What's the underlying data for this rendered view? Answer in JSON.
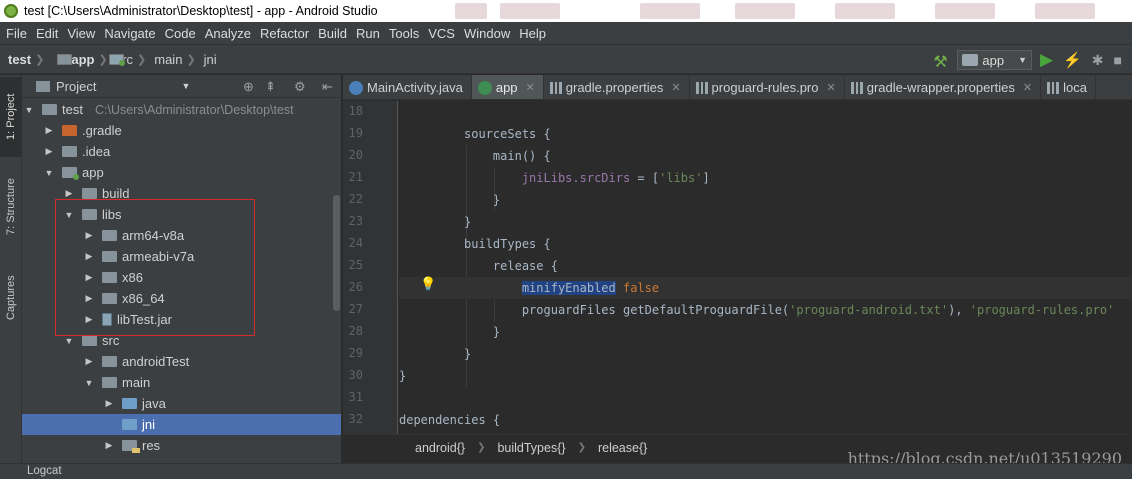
{
  "window": {
    "title": "test [C:\\Users\\Administrator\\Desktop\\test] - app - Android Studio"
  },
  "menu": [
    "File",
    "Edit",
    "View",
    "Navigate",
    "Code",
    "Analyze",
    "Refactor",
    "Build",
    "Run",
    "Tools",
    "VCS",
    "Window",
    "Help"
  ],
  "breadcrumb": [
    "test",
    "app",
    "src",
    "main",
    "jni"
  ],
  "run_config": "app",
  "left_tabs": [
    "1: Project",
    "7: Structure",
    "Captures"
  ],
  "project_panel": {
    "title": "Project",
    "tree": [
      {
        "label": "test",
        "path": "C:\\Users\\Administrator\\Desktop\\test"
      },
      {
        "label": ".gradle"
      },
      {
        "label": ".idea"
      },
      {
        "label": "app"
      },
      {
        "label": "build"
      },
      {
        "label": "libs"
      },
      {
        "label": "arm64-v8a"
      },
      {
        "label": "armeabi-v7a"
      },
      {
        "label": "x86"
      },
      {
        "label": "x86_64"
      },
      {
        "label": "libTest.jar"
      },
      {
        "label": "src"
      },
      {
        "label": "androidTest"
      },
      {
        "label": "main"
      },
      {
        "label": "java"
      },
      {
        "label": "jni"
      },
      {
        "label": "res"
      }
    ]
  },
  "tabs": [
    "MainActivity.java",
    "app",
    "gradle.properties",
    "proguard-rules.pro",
    "gradle-wrapper.properties",
    "loca"
  ],
  "editor": {
    "line_numbers": [
      "18",
      "19",
      "20",
      "21",
      "22",
      "23",
      "24",
      "25",
      "26",
      "27",
      "28",
      "29",
      "30",
      "31",
      "32"
    ],
    "code": {
      "l19": "sourceSets {",
      "l20": "main() {",
      "l21_field": "jniLibs.srcDirs",
      "l21_eq": " = [",
      "l21_str": "'libs'",
      "l21_end": "]",
      "l22": "}",
      "l23": "}",
      "l24": "buildTypes {",
      "l25": "release {",
      "l26_sel": "minifyEnabled",
      "l26_kw": "false",
      "l27_a": "proguardFiles getDefaultProguardFile(",
      "l27_s1": "'proguard-android.txt'",
      "l27_b": "), ",
      "l27_s2": "'proguard-rules.pro'",
      "l28": "}",
      "l29": "}",
      "l30": "}",
      "l32": "dependencies {"
    }
  },
  "code_breadcrumb": [
    "android{}",
    "buildTypes{}",
    "release{}"
  ],
  "watermark": "https://blog.csdn.net/u013519290",
  "bottom_tool": "Logcat"
}
